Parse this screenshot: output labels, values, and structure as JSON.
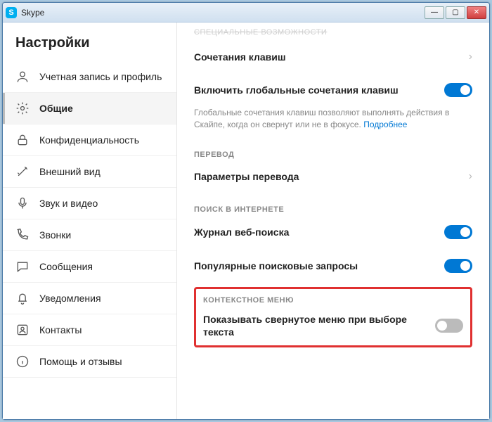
{
  "window": {
    "title": "Skype"
  },
  "sidebar": {
    "heading": "Настройки",
    "items": [
      {
        "label": "Учетная запись и профиль"
      },
      {
        "label": "Общие"
      },
      {
        "label": "Конфиденциальность"
      },
      {
        "label": "Внешний вид"
      },
      {
        "label": "Звук и видео"
      },
      {
        "label": "Звонки"
      },
      {
        "label": "Сообщения"
      },
      {
        "label": "Уведомления"
      },
      {
        "label": "Контакты"
      },
      {
        "label": "Помощь и отзывы"
      }
    ]
  },
  "content": {
    "truncated_header": "Специальные возможности",
    "shortcuts_label": "Сочетания клавиш",
    "global_shortcuts": {
      "label": "Включить глобальные сочетания клавиш",
      "enabled": true,
      "description": "Глобальные сочетания клавиш позволяют выполнять действия в Скайпе, когда он свернут или не в фокусе.",
      "more_link": "Подробнее"
    },
    "translation": {
      "section": "Перевод",
      "params_label": "Параметры перевода"
    },
    "web_search": {
      "section": "ПОИСК В ИНТЕРНЕТЕ",
      "history_label": "Журнал веб-поиска",
      "history_enabled": true,
      "popular_label": "Популярные поисковые запросы",
      "popular_enabled": true
    },
    "context_menu": {
      "section": "КОНТЕКСТНОЕ МЕНЮ",
      "show_collapsed_label": "Показывать свернутое меню при выборе текста",
      "show_collapsed_enabled": false
    }
  }
}
